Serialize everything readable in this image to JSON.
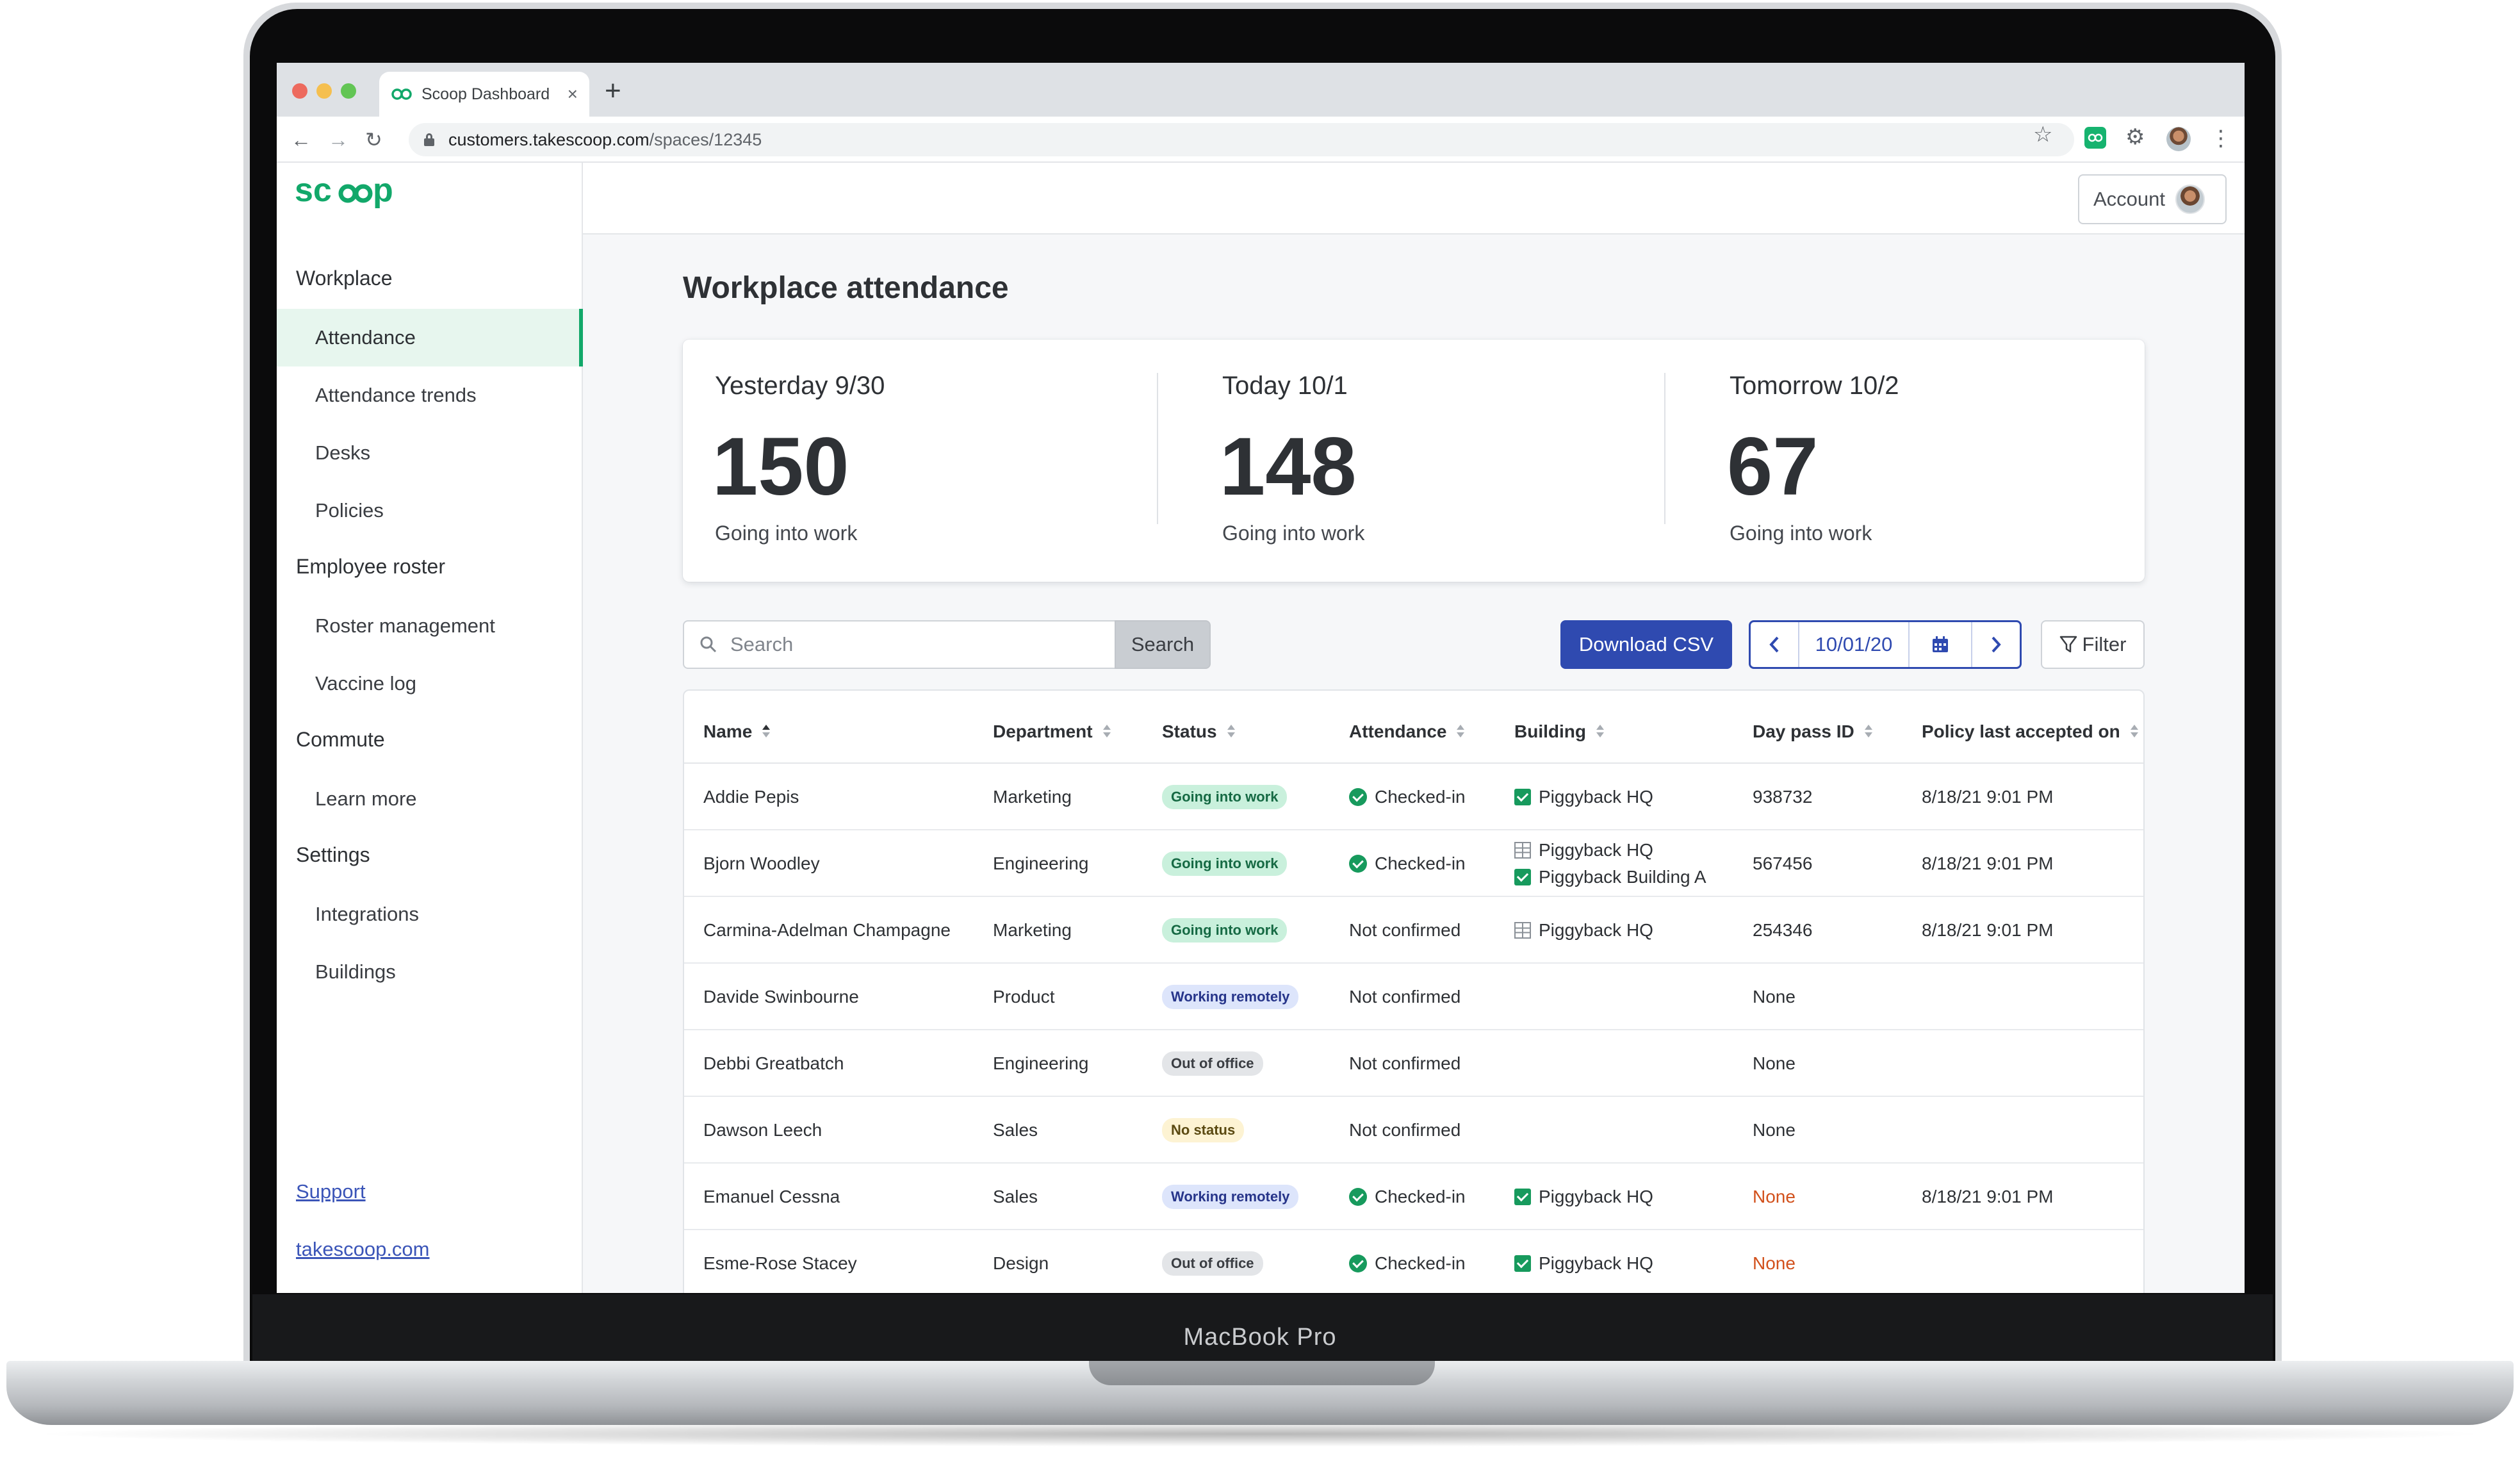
{
  "device": {
    "model_label": "MacBook Pro"
  },
  "browser": {
    "tab_title": "Scoop Dashboard",
    "tab_close": "×",
    "new_tab": "+",
    "url_host": "customers.takescoop.com",
    "url_path": "/spaces/12345",
    "icons": [
      "back-icon",
      "forward-icon",
      "reload-icon",
      "lock-icon",
      "star-icon",
      "scoop-extension-icon",
      "puzzle-icon",
      "profile-avatar",
      "kebab-menu-icon"
    ]
  },
  "brand": {
    "logo": "scoop",
    "color": "#12a86a"
  },
  "sidebar": {
    "sections": [
      {
        "label": "Workplace",
        "items": [
          {
            "label": "Attendance",
            "active": true
          },
          {
            "label": "Attendance trends"
          },
          {
            "label": "Desks"
          },
          {
            "label": "Policies"
          }
        ]
      },
      {
        "label": "Employee roster",
        "items": [
          {
            "label": "Roster management"
          },
          {
            "label": "Vaccine log"
          }
        ]
      },
      {
        "label": "Commute",
        "items": [
          {
            "label": "Learn more"
          }
        ]
      },
      {
        "label": "Settings",
        "items": [
          {
            "label": "Integrations"
          },
          {
            "label": "Buildings"
          }
        ]
      }
    ],
    "footer_links": [
      "Support",
      "takescoop.com"
    ]
  },
  "header": {
    "account_label": "Account"
  },
  "page": {
    "title": "Workplace attendance"
  },
  "stats": [
    {
      "label": "Yesterday 9/30",
      "value": "150",
      "sub": "Going into work"
    },
    {
      "label": "Today 10/1",
      "value": "148",
      "sub": "Going into work"
    },
    {
      "label": "Tomorrow 10/2",
      "value": "67",
      "sub": "Going into work"
    }
  ],
  "controls": {
    "search_placeholder": "Search",
    "search_button": "Search",
    "download_csv": "Download CSV",
    "date_value": "10/01/20",
    "filter": "Filter",
    "accent_color": "#2f4ab0"
  },
  "table": {
    "columns": [
      "Name",
      "Department",
      "Status",
      "Attendance",
      "Building",
      "Day pass ID",
      "Policy last accepted on"
    ],
    "sorted_column": "Name",
    "rows": [
      {
        "name": "Addie Pepis",
        "department": "Marketing",
        "status": "Going into work",
        "attendance": "Checked-in",
        "buildings": [
          {
            "name": "Piggyback HQ",
            "checked": true
          }
        ],
        "day_pass_id": "938732",
        "policy": "8/18/21 9:01 PM"
      },
      {
        "name": "Bjorn Woodley",
        "department": "Engineering",
        "status": "Going into work",
        "attendance": "Checked-in",
        "buildings": [
          {
            "name": "Piggyback HQ",
            "checked": false
          },
          {
            "name": "Piggyback Building A",
            "checked": true
          }
        ],
        "day_pass_id": "567456",
        "policy": "8/18/21 9:01 PM"
      },
      {
        "name": "Carmina-Adelman Champagne",
        "department": "Marketing",
        "status": "Going into work",
        "attendance": "Not confirmed",
        "buildings": [
          {
            "name": "Piggyback HQ",
            "checked": false
          }
        ],
        "day_pass_id": "254346",
        "policy": "8/18/21 9:01 PM"
      },
      {
        "name": "Davide Swinbourne",
        "department": "Product",
        "status": "Working remotely",
        "attendance": "Not confirmed",
        "buildings": [],
        "day_pass_id": "None",
        "policy": ""
      },
      {
        "name": "Debbi Greatbatch",
        "department": "Engineering",
        "status": "Out of office",
        "attendance": "Not confirmed",
        "buildings": [],
        "day_pass_id": "None",
        "policy": ""
      },
      {
        "name": "Dawson Leech",
        "department": "Sales",
        "status": "No status",
        "attendance": "Not confirmed",
        "buildings": [],
        "day_pass_id": "None",
        "policy": ""
      },
      {
        "name": "Emanuel Cessna",
        "department": "Sales",
        "status": "Working remotely",
        "attendance": "Checked-in",
        "buildings": [
          {
            "name": "Piggyback HQ",
            "checked": true
          }
        ],
        "day_pass_id": "None",
        "day_pass_alert": true,
        "policy": "8/18/21 9:01 PM"
      },
      {
        "name": "Esme-Rose Stacey",
        "department": "Design",
        "status": "Out of office",
        "attendance": "Checked-in",
        "buildings": [
          {
            "name": "Piggyback HQ",
            "checked": true
          }
        ],
        "day_pass_id": "None",
        "day_pass_alert": true,
        "policy": ""
      }
    ]
  }
}
